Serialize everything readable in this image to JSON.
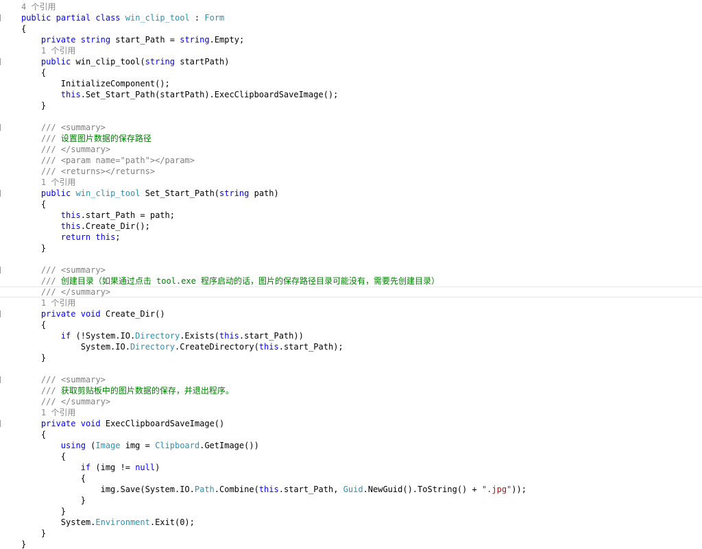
{
  "editor": {
    "language": "C#",
    "colors": {
      "keyword": "#0000ff",
      "type": "#2b91af",
      "comment": "#008000",
      "doc_tag": "#808080",
      "string": "#a31515",
      "codelens": "#8a8a8a",
      "text": "#000000"
    },
    "lines": [
      {
        "kind": "codelens",
        "tokens": [
          {
            "t": "ref",
            "s": "4 个引用"
          }
        ]
      },
      {
        "kind": "code",
        "mark": true,
        "tokens": [
          {
            "t": "kw",
            "s": "public"
          },
          {
            "t": "plain",
            "s": " "
          },
          {
            "t": "kw",
            "s": "partial"
          },
          {
            "t": "plain",
            "s": " "
          },
          {
            "t": "kw",
            "s": "class"
          },
          {
            "t": "plain",
            "s": " "
          },
          {
            "t": "type",
            "s": "win_clip_tool"
          },
          {
            "t": "plain",
            "s": " : "
          },
          {
            "t": "type",
            "s": "Form"
          }
        ]
      },
      {
        "kind": "code",
        "tokens": [
          {
            "t": "plain",
            "s": "{"
          }
        ]
      },
      {
        "kind": "code",
        "tokens": [
          {
            "t": "plain",
            "s": "    "
          },
          {
            "t": "kw",
            "s": "private"
          },
          {
            "t": "plain",
            "s": " "
          },
          {
            "t": "kw",
            "s": "string"
          },
          {
            "t": "plain",
            "s": " start_Path = "
          },
          {
            "t": "kw",
            "s": "string"
          },
          {
            "t": "plain",
            "s": ".Empty;"
          }
        ]
      },
      {
        "kind": "codelens",
        "tokens": [
          {
            "t": "plain",
            "s": "    "
          },
          {
            "t": "ref",
            "s": "1 个引用"
          }
        ]
      },
      {
        "kind": "code",
        "mark": true,
        "tokens": [
          {
            "t": "plain",
            "s": "    "
          },
          {
            "t": "kw",
            "s": "public"
          },
          {
            "t": "plain",
            "s": " win_clip_tool("
          },
          {
            "t": "kw",
            "s": "string"
          },
          {
            "t": "plain",
            "s": " startPath)"
          }
        ]
      },
      {
        "kind": "code",
        "tokens": [
          {
            "t": "plain",
            "s": "    {"
          }
        ]
      },
      {
        "kind": "code",
        "tokens": [
          {
            "t": "plain",
            "s": "        InitializeComponent();"
          }
        ]
      },
      {
        "kind": "code",
        "tokens": [
          {
            "t": "plain",
            "s": "        "
          },
          {
            "t": "kw",
            "s": "this"
          },
          {
            "t": "plain",
            "s": ".Set_Start_Path(startPath).ExecClipboardSaveImage();"
          }
        ]
      },
      {
        "kind": "code",
        "tokens": [
          {
            "t": "plain",
            "s": "    }"
          }
        ]
      },
      {
        "kind": "blank",
        "tokens": []
      },
      {
        "kind": "comment",
        "mark": true,
        "tokens": [
          {
            "t": "plain",
            "s": "    "
          },
          {
            "t": "doc",
            "s": "/// "
          },
          {
            "t": "doc",
            "s": "<summary>"
          }
        ]
      },
      {
        "kind": "comment",
        "tokens": [
          {
            "t": "plain",
            "s": "    "
          },
          {
            "t": "doc",
            "s": "/// "
          },
          {
            "t": "comment",
            "s": "设置图片数据的保存路径"
          }
        ]
      },
      {
        "kind": "comment",
        "tokens": [
          {
            "t": "plain",
            "s": "    "
          },
          {
            "t": "doc",
            "s": "/// "
          },
          {
            "t": "doc",
            "s": "</summary>"
          }
        ]
      },
      {
        "kind": "comment",
        "tokens": [
          {
            "t": "plain",
            "s": "    "
          },
          {
            "t": "doc",
            "s": "/// "
          },
          {
            "t": "doc",
            "s": "<param name=\"path\"></param>"
          }
        ]
      },
      {
        "kind": "comment",
        "tokens": [
          {
            "t": "plain",
            "s": "    "
          },
          {
            "t": "doc",
            "s": "/// "
          },
          {
            "t": "doc",
            "s": "<returns></returns>"
          }
        ]
      },
      {
        "kind": "codelens",
        "tokens": [
          {
            "t": "plain",
            "s": "    "
          },
          {
            "t": "ref",
            "s": "1 个引用"
          }
        ]
      },
      {
        "kind": "code",
        "mark": true,
        "tokens": [
          {
            "t": "plain",
            "s": "    "
          },
          {
            "t": "kw",
            "s": "public"
          },
          {
            "t": "plain",
            "s": " "
          },
          {
            "t": "type",
            "s": "win_clip_tool"
          },
          {
            "t": "plain",
            "s": " Set_Start_Path("
          },
          {
            "t": "kw",
            "s": "string"
          },
          {
            "t": "plain",
            "s": " path)"
          }
        ]
      },
      {
        "kind": "code",
        "tokens": [
          {
            "t": "plain",
            "s": "    {"
          }
        ]
      },
      {
        "kind": "code",
        "tokens": [
          {
            "t": "plain",
            "s": "        "
          },
          {
            "t": "kw",
            "s": "this"
          },
          {
            "t": "plain",
            "s": ".start_Path = path;"
          }
        ]
      },
      {
        "kind": "code",
        "tokens": [
          {
            "t": "plain",
            "s": "        "
          },
          {
            "t": "kw",
            "s": "this"
          },
          {
            "t": "plain",
            "s": ".Create_Dir();"
          }
        ]
      },
      {
        "kind": "code",
        "tokens": [
          {
            "t": "plain",
            "s": "        "
          },
          {
            "t": "kw",
            "s": "return"
          },
          {
            "t": "plain",
            "s": " "
          },
          {
            "t": "kw",
            "s": "this"
          },
          {
            "t": "plain",
            "s": ";"
          }
        ]
      },
      {
        "kind": "code",
        "tokens": [
          {
            "t": "plain",
            "s": "    }"
          }
        ]
      },
      {
        "kind": "blank",
        "tokens": []
      },
      {
        "kind": "comment",
        "mark": true,
        "tokens": [
          {
            "t": "plain",
            "s": "    "
          },
          {
            "t": "doc",
            "s": "/// "
          },
          {
            "t": "doc",
            "s": "<summary>"
          }
        ]
      },
      {
        "kind": "comment",
        "tokens": [
          {
            "t": "plain",
            "s": "    "
          },
          {
            "t": "doc",
            "s": "/// "
          },
          {
            "t": "comment",
            "s": "创建目录（如果通过点击 tool.exe 程序启动的话，图片的保存路径目录可能没有，需要先创建目录）"
          }
        ]
      },
      {
        "kind": "comment",
        "current": true,
        "tokens": [
          {
            "t": "plain",
            "s": "    "
          },
          {
            "t": "doc",
            "s": "/// "
          },
          {
            "t": "doc",
            "s": "</summary>"
          }
        ]
      },
      {
        "kind": "codelens",
        "tokens": [
          {
            "t": "plain",
            "s": "    "
          },
          {
            "t": "ref",
            "s": "1 个引用"
          }
        ]
      },
      {
        "kind": "code",
        "mark": true,
        "tokens": [
          {
            "t": "plain",
            "s": "    "
          },
          {
            "t": "kw",
            "s": "private"
          },
          {
            "t": "plain",
            "s": " "
          },
          {
            "t": "kw",
            "s": "void"
          },
          {
            "t": "plain",
            "s": " Create_Dir()"
          }
        ]
      },
      {
        "kind": "code",
        "tokens": [
          {
            "t": "plain",
            "s": "    {"
          }
        ]
      },
      {
        "kind": "code",
        "tokens": [
          {
            "t": "plain",
            "s": "        "
          },
          {
            "t": "kw",
            "s": "if"
          },
          {
            "t": "plain",
            "s": " (!System.IO."
          },
          {
            "t": "type",
            "s": "Directory"
          },
          {
            "t": "plain",
            "s": ".Exists("
          },
          {
            "t": "kw",
            "s": "this"
          },
          {
            "t": "plain",
            "s": ".start_Path))"
          }
        ]
      },
      {
        "kind": "code",
        "tokens": [
          {
            "t": "plain",
            "s": "            System.IO."
          },
          {
            "t": "type",
            "s": "Directory"
          },
          {
            "t": "plain",
            "s": ".CreateDirectory("
          },
          {
            "t": "kw",
            "s": "this"
          },
          {
            "t": "plain",
            "s": ".start_Path);"
          }
        ]
      },
      {
        "kind": "code",
        "tokens": [
          {
            "t": "plain",
            "s": "    }"
          }
        ]
      },
      {
        "kind": "blank",
        "tokens": []
      },
      {
        "kind": "comment",
        "mark": true,
        "tokens": [
          {
            "t": "plain",
            "s": "    "
          },
          {
            "t": "doc",
            "s": "/// "
          },
          {
            "t": "doc",
            "s": "<summary>"
          }
        ]
      },
      {
        "kind": "comment",
        "tokens": [
          {
            "t": "plain",
            "s": "    "
          },
          {
            "t": "doc",
            "s": "/// "
          },
          {
            "t": "comment",
            "s": "获取剪贴板中的图片数据的保存，并退出程序。"
          }
        ]
      },
      {
        "kind": "comment",
        "tokens": [
          {
            "t": "plain",
            "s": "    "
          },
          {
            "t": "doc",
            "s": "/// "
          },
          {
            "t": "doc",
            "s": "</summary>"
          }
        ]
      },
      {
        "kind": "codelens",
        "tokens": [
          {
            "t": "plain",
            "s": "    "
          },
          {
            "t": "ref",
            "s": "1 个引用"
          }
        ]
      },
      {
        "kind": "code",
        "mark": true,
        "tokens": [
          {
            "t": "plain",
            "s": "    "
          },
          {
            "t": "kw",
            "s": "private"
          },
          {
            "t": "plain",
            "s": " "
          },
          {
            "t": "kw",
            "s": "void"
          },
          {
            "t": "plain",
            "s": " ExecClipboardSaveImage()"
          }
        ]
      },
      {
        "kind": "code",
        "tokens": [
          {
            "t": "plain",
            "s": "    {"
          }
        ]
      },
      {
        "kind": "code",
        "tokens": [
          {
            "t": "plain",
            "s": "        "
          },
          {
            "t": "kw",
            "s": "using"
          },
          {
            "t": "plain",
            "s": " ("
          },
          {
            "t": "type",
            "s": "Image"
          },
          {
            "t": "plain",
            "s": " img = "
          },
          {
            "t": "type",
            "s": "Clipboard"
          },
          {
            "t": "plain",
            "s": ".GetImage())"
          }
        ]
      },
      {
        "kind": "code",
        "tokens": [
          {
            "t": "plain",
            "s": "        {"
          }
        ]
      },
      {
        "kind": "code",
        "tokens": [
          {
            "t": "plain",
            "s": "            "
          },
          {
            "t": "kw",
            "s": "if"
          },
          {
            "t": "plain",
            "s": " (img != "
          },
          {
            "t": "kw",
            "s": "null"
          },
          {
            "t": "plain",
            "s": ")"
          }
        ]
      },
      {
        "kind": "code",
        "tokens": [
          {
            "t": "plain",
            "s": "            {"
          }
        ]
      },
      {
        "kind": "code",
        "tokens": [
          {
            "t": "plain",
            "s": "                img.Save(System.IO."
          },
          {
            "t": "type",
            "s": "Path"
          },
          {
            "t": "plain",
            "s": ".Combine("
          },
          {
            "t": "kw",
            "s": "this"
          },
          {
            "t": "plain",
            "s": ".start_Path, "
          },
          {
            "t": "type",
            "s": "Guid"
          },
          {
            "t": "plain",
            "s": ".NewGuid().ToString() + "
          },
          {
            "t": "str",
            "s": "\".jpg\""
          },
          {
            "t": "plain",
            "s": "));"
          }
        ]
      },
      {
        "kind": "code",
        "tokens": [
          {
            "t": "plain",
            "s": "            }"
          }
        ]
      },
      {
        "kind": "code",
        "tokens": [
          {
            "t": "plain",
            "s": "        }"
          }
        ]
      },
      {
        "kind": "code",
        "tokens": [
          {
            "t": "plain",
            "s": "        System."
          },
          {
            "t": "type",
            "s": "Environment"
          },
          {
            "t": "plain",
            "s": ".Exit(0);"
          }
        ]
      },
      {
        "kind": "code",
        "tokens": [
          {
            "t": "plain",
            "s": "    }"
          }
        ]
      },
      {
        "kind": "code",
        "tokens": [
          {
            "t": "plain",
            "s": "}"
          }
        ]
      }
    ]
  }
}
